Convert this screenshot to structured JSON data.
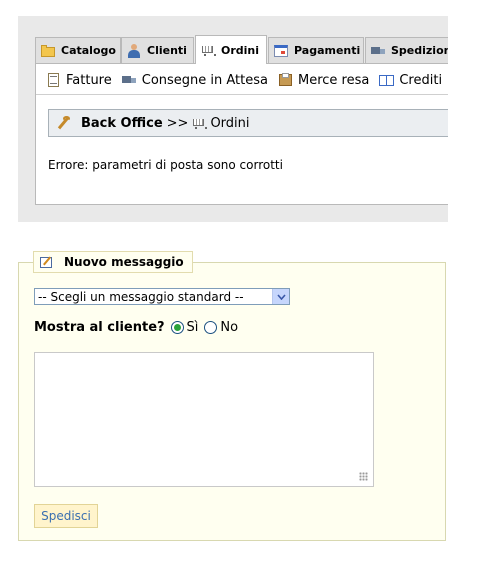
{
  "tabs": [
    {
      "label": "Catalogo",
      "icon": "folder-icon"
    },
    {
      "label": "Clienti",
      "icon": "user-icon"
    },
    {
      "label": "Ordini",
      "icon": "cart-icon",
      "active": true
    },
    {
      "label": "Pagamenti",
      "icon": "calendar-icon"
    },
    {
      "label": "Spedizioni",
      "icon": "truck-icon"
    }
  ],
  "subnav": [
    {
      "label": "Fatture",
      "icon": "invoice-icon"
    },
    {
      "label": "Consegne in Attesa",
      "icon": "delivery-truck-icon"
    },
    {
      "label": "Merce resa",
      "icon": "box-icon"
    },
    {
      "label": "Crediti",
      "icon": "book-icon"
    }
  ],
  "breadcrumb": {
    "root": "Back Office",
    "separator": ">>",
    "current": "Ordini"
  },
  "error_message": "Errore: parametri di posta sono corrotti",
  "message_form": {
    "legend": "Nuovo messaggio",
    "select_value": "-- Scegli un messaggio standard --",
    "show_label": "Mostra al cliente?",
    "radio_yes": "Sì",
    "radio_no": "No",
    "selected": "Sì",
    "textarea_value": "",
    "submit_label": "Spedisci"
  },
  "colors": {
    "panel_bg": "#e9e9e9",
    "form_bg": "#fffff0",
    "button_bg": "#fff4cc",
    "link_blue": "#3a6fb0"
  }
}
